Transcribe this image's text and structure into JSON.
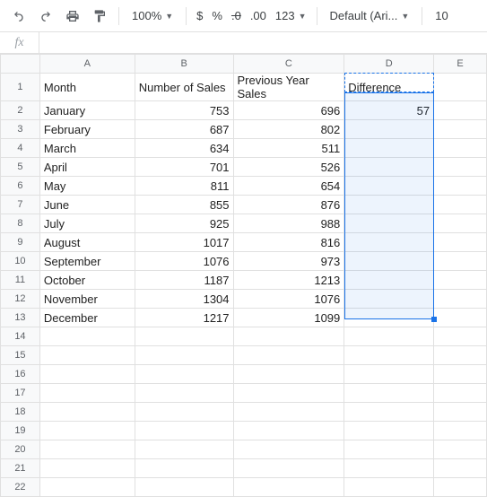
{
  "toolbar": {
    "zoom": "100%",
    "font": "Default (Ari...",
    "fontsize": "10",
    "currency": "$",
    "percent": "%",
    "dec_dec": ".0",
    "inc_dec": ".00",
    "numfmt": "123"
  },
  "fx": {
    "label": "fx",
    "value": ""
  },
  "columns": [
    "A",
    "B",
    "C",
    "D",
    "E"
  ],
  "headers": {
    "A": "Month",
    "B": "Number of Sales",
    "C": "Previous Year Sales",
    "D": "Difference"
  },
  "rows": [
    {
      "A": "January",
      "B": "753",
      "C": "696",
      "D": "57"
    },
    {
      "A": "February",
      "B": "687",
      "C": "802",
      "D": ""
    },
    {
      "A": "March",
      "B": "634",
      "C": "511",
      "D": ""
    },
    {
      "A": "April",
      "B": "701",
      "C": "526",
      "D": ""
    },
    {
      "A": "May",
      "B": "811",
      "C": "654",
      "D": ""
    },
    {
      "A": "June",
      "B": "855",
      "C": "876",
      "D": ""
    },
    {
      "A": "July",
      "B": "925",
      "C": "988",
      "D": ""
    },
    {
      "A": "August",
      "B": "1017",
      "C": "816",
      "D": ""
    },
    {
      "A": "September",
      "B": "1076",
      "C": "973",
      "D": ""
    },
    {
      "A": "October",
      "B": "1187",
      "C": "1213",
      "D": ""
    },
    {
      "A": "November",
      "B": "1304",
      "C": "1076",
      "D": ""
    },
    {
      "A": "December",
      "B": "1217",
      "C": "1099",
      "D": ""
    }
  ],
  "total_rows": 22
}
